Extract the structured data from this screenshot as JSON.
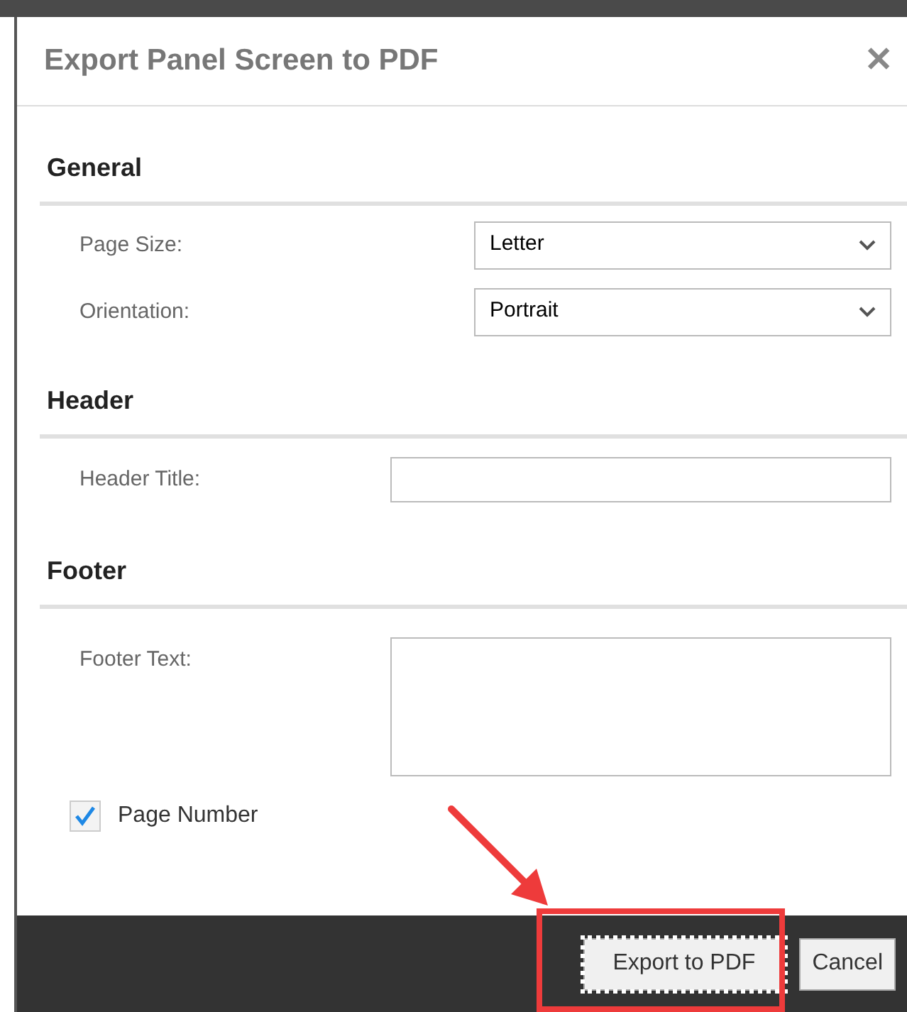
{
  "dialog": {
    "title": "Export Panel Screen to PDF",
    "close": "✕"
  },
  "sections": [
    {
      "heading": "General",
      "fields": [
        {
          "kind": "select",
          "label": "Page Size:",
          "value": "Letter"
        },
        {
          "kind": "select",
          "label": "Orientation:",
          "value": "Portrait"
        }
      ]
    },
    {
      "heading": "Header",
      "fields": [
        {
          "kind": "input",
          "label": "Header Title:"
        }
      ]
    },
    {
      "heading": "Footer",
      "fields": [
        {
          "kind": "textarea",
          "label": "Footer Text:"
        }
      ]
    }
  ],
  "page_number": {
    "label": "Page Number",
    "checked": true
  },
  "buttons": [
    {
      "label": "Export to PDF",
      "focused": true
    },
    {
      "label": "Cancel",
      "focused": false
    }
  ]
}
